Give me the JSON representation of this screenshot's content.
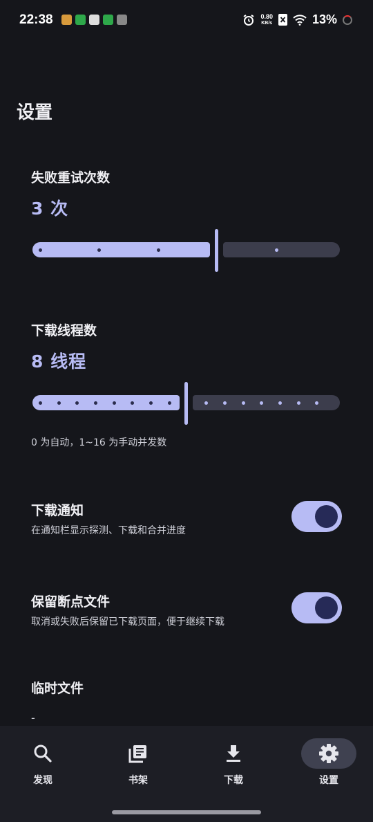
{
  "status_bar": {
    "time": "22:38",
    "net_speed_value": "0.80",
    "net_speed_unit": "KB/s",
    "battery": "13%"
  },
  "page": {
    "title": "设置"
  },
  "retry": {
    "label": "失败重试次数",
    "value_text": "3 次",
    "value": 3,
    "min": 0,
    "max": 5
  },
  "threads": {
    "label": "下载线程数",
    "value_text": "8 线程",
    "value": 8,
    "min": 0,
    "max": 16,
    "hint": "0 为自动，1~16 为手动并发数"
  },
  "download_notification": {
    "title": "下载通知",
    "subtitle": "在通知栏显示探测、下载和合并进度",
    "enabled": true
  },
  "keep_partial_files": {
    "title": "保留断点文件",
    "subtitle": "取消或失败后保留已下载页面，便于继续下载",
    "enabled": true
  },
  "temp_files": {
    "title": "临时文件",
    "value": "-"
  },
  "nav": {
    "items": [
      {
        "label": "发现",
        "icon": "search-icon",
        "active": false
      },
      {
        "label": "书架",
        "icon": "library-icon",
        "active": false
      },
      {
        "label": "下载",
        "icon": "download-icon",
        "active": false
      },
      {
        "label": "设置",
        "icon": "gear-icon",
        "active": true
      }
    ]
  },
  "colors": {
    "accent": "#b7bbf4",
    "background": "#15161b",
    "track_inactive": "#3c3d4c",
    "switch_knob": "#262a57"
  }
}
